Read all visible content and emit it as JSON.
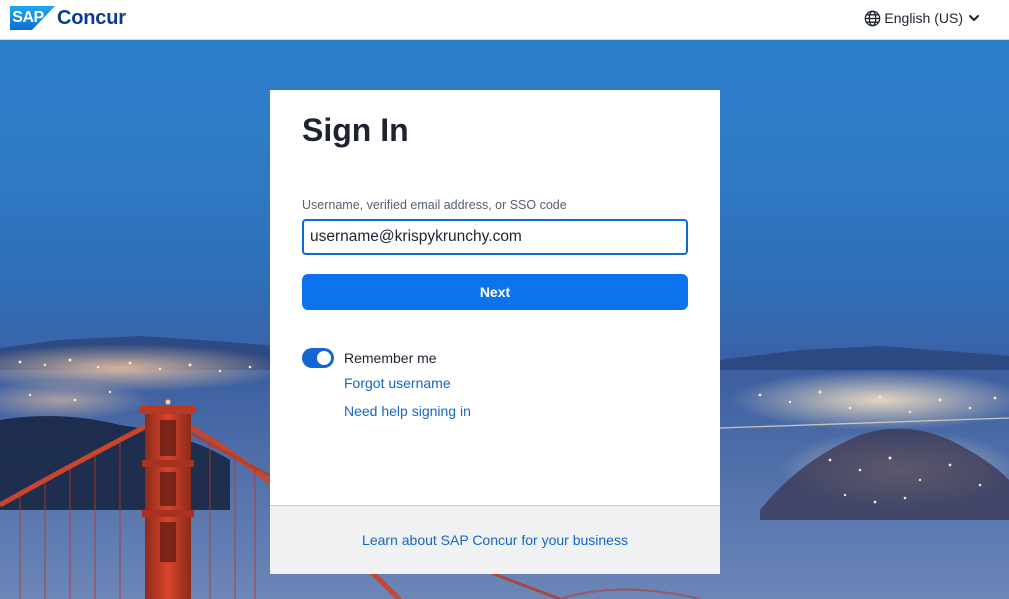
{
  "header": {
    "logo": {
      "sap_text": "SAP",
      "concur_text": "Concur"
    },
    "language": {
      "label": "English (US)",
      "icon": "globe-icon",
      "dropdown_icon": "chevron-down-icon"
    }
  },
  "background": {
    "description_icon": "golden-gate-bridge-night-scene"
  },
  "signin": {
    "title": "Sign In",
    "username_label": "Username, verified email address, or SSO code",
    "username_value": "username@krispykrunchy.com",
    "next_label": "Next",
    "remember_label": "Remember me",
    "remember_checked": true,
    "forgot_username_label": "Forgot username",
    "help_label": "Need help signing in",
    "footer_link_label": "Learn about SAP Concur for your business"
  },
  "colors": {
    "primary_button": "#0b73ee",
    "link": "#1466c8",
    "focus_border": "#0a6ed1",
    "toggle_on": "#1266d4",
    "brand_blue": "#0a3d8f"
  }
}
